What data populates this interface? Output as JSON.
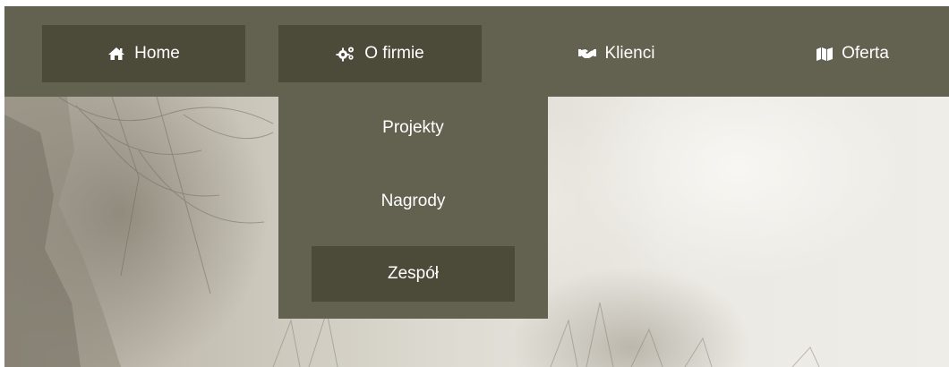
{
  "nav": {
    "items": [
      {
        "label": "Home",
        "icon": "home-icon"
      },
      {
        "label": "O firmie",
        "icon": "gears-icon"
      },
      {
        "label": "Klienci",
        "icon": "handshake-icon"
      },
      {
        "label": "Oferta",
        "icon": "map-icon"
      }
    ],
    "dropdown": [
      {
        "label": "Projekty"
      },
      {
        "label": "Nagrody"
      },
      {
        "label": "Zespół",
        "active": true
      }
    ]
  },
  "colors": {
    "nav_bg": "#636150",
    "nav_box": "#4c4b3a",
    "text": "#ffffff"
  }
}
